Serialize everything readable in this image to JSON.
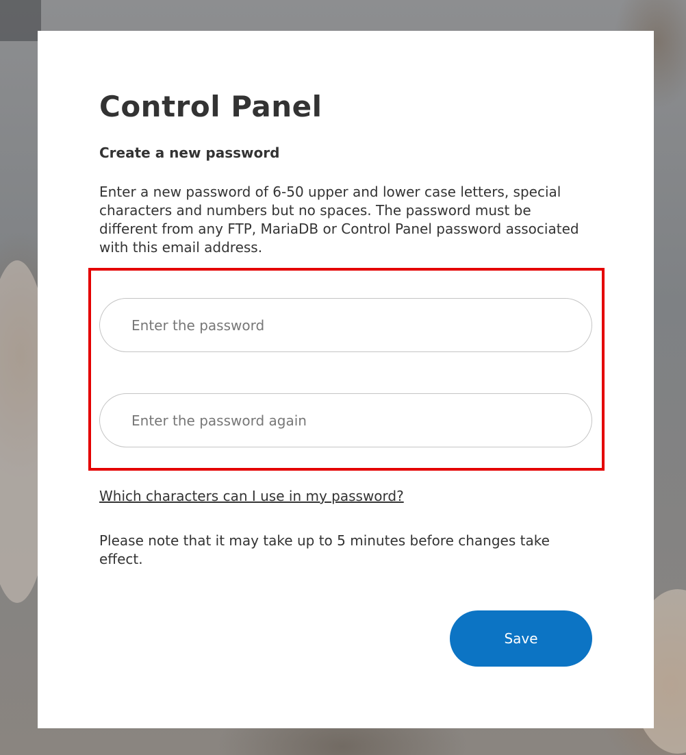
{
  "page": {
    "title": "Control Panel",
    "subtitle": "Create a new password",
    "instructions": "Enter a new password of 6-50 upper and lower case letters, special characters and numbers but no spaces. The password must be different from any FTP, MariaDB or Control Panel password associated with this email address."
  },
  "form": {
    "password_placeholder": "Enter the password",
    "password_value": "",
    "confirm_placeholder": "Enter the password again",
    "confirm_value": "",
    "help_link": "Which characters can I use in my password?",
    "note": "Please note that it may take up to 5 minutes before changes take effect.",
    "save_label": "Save"
  },
  "colors": {
    "highlight": "#e40000",
    "button": "#0c74c4",
    "text": "#333333"
  }
}
